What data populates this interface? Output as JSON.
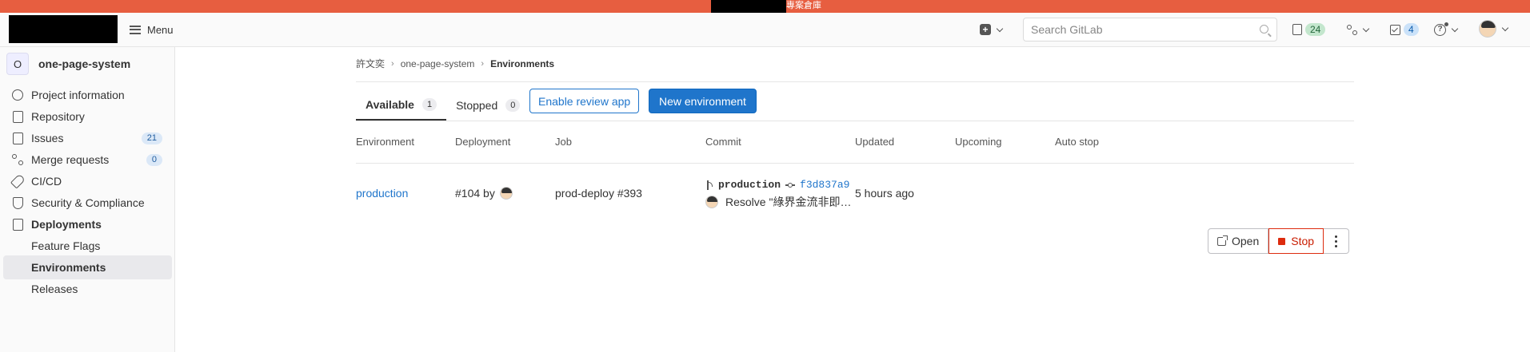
{
  "system_bar": {
    "text": "專案倉庫"
  },
  "navbar": {
    "menu_label": "Menu",
    "search_placeholder": "Search GitLab",
    "issues_count": "24",
    "todos_count": "4"
  },
  "sidebar": {
    "project_initial": "O",
    "project_name": "one-page-system",
    "items": [
      {
        "label": "Project information",
        "icon": "info-icon"
      },
      {
        "label": "Repository",
        "icon": "doc-icon"
      },
      {
        "label": "Issues",
        "icon": "issues-icon",
        "count": "21"
      },
      {
        "label": "Merge requests",
        "icon": "merge-request-icon",
        "count": "0"
      },
      {
        "label": "CI/CD",
        "icon": "rocket-icon"
      },
      {
        "label": "Security & Compliance",
        "icon": "shield-icon"
      },
      {
        "label": "Deployments",
        "icon": "deployments-icon"
      },
      {
        "label": "Feature Flags"
      },
      {
        "label": "Environments"
      },
      {
        "label": "Releases"
      }
    ]
  },
  "breadcrumbs": [
    "許文奕",
    "one-page-system",
    "Environments"
  ],
  "tabs": [
    {
      "label": "Available",
      "count": "1"
    },
    {
      "label": "Stopped",
      "count": "0"
    }
  ],
  "buttons": {
    "review_app": "Enable review app",
    "new_env": "New environment"
  },
  "table": {
    "headers": [
      "Environment",
      "Deployment",
      "Job",
      "Commit",
      "Updated",
      "Upcoming",
      "Auto stop"
    ],
    "row": {
      "environment": "production",
      "deployment": "#104 by",
      "job": "prod-deploy #393",
      "ref": "production",
      "sha": "f3d837a9",
      "commit_title": "Resolve \"綠界金流非即時付款\"",
      "updated": "5 hours ago",
      "open_label": "Open",
      "stop_label": "Stop"
    }
  }
}
